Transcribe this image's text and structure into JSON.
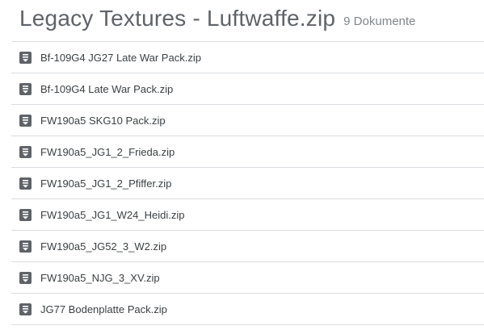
{
  "folder": {
    "title": "Legacy Textures - Luftwaffe.zip",
    "count_label": "9 Dokumente"
  },
  "items": [
    {
      "name": "Bf-109G4 JG27 Late War Pack.zip",
      "icon": "archive-file-icon"
    },
    {
      "name": "Bf-109G4 Late War Pack.zip",
      "icon": "archive-file-icon"
    },
    {
      "name": "FW190a5 SKG10 Pack.zip",
      "icon": "archive-file-icon"
    },
    {
      "name": "FW190a5_JG1_2_Frieda.zip",
      "icon": "archive-file-icon"
    },
    {
      "name": "FW190a5_JG1_2_Pfiffer.zip",
      "icon": "archive-file-icon"
    },
    {
      "name": "FW190a5_JG1_W24_Heidi.zip",
      "icon": "archive-file-icon"
    },
    {
      "name": "FW190a5_JG52_3_W2.zip",
      "icon": "archive-file-icon"
    },
    {
      "name": "FW190a5_NJG_3_XV.zip",
      "icon": "archive-file-icon"
    },
    {
      "name": "JG77 Bodenplatte Pack.zip",
      "icon": "archive-file-icon"
    }
  ],
  "colors": {
    "icon": "#5f6368",
    "divider": "#dadce0",
    "title": "#5f6368"
  }
}
